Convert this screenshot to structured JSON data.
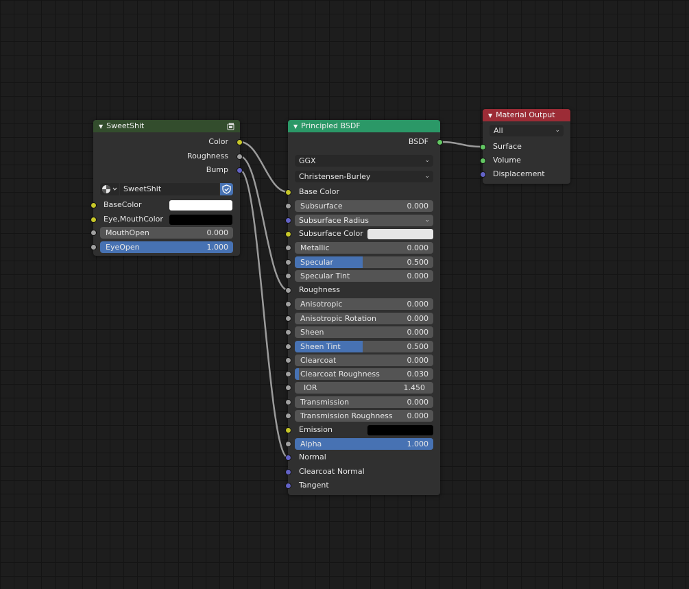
{
  "colors": {
    "group_header": "#334d2d",
    "shader_header": "#2b9867",
    "output_header": "#9c2c36",
    "accent_blue": "#4772b3",
    "socket_yellow": "#c7c729",
    "socket_gray": "#a1a1a1",
    "socket_blue": "#6363c7",
    "socket_green": "#63c763",
    "wire": "#9b9b9b"
  },
  "group_node": {
    "title": "SweetShit",
    "header_icon": "node-tree-icon",
    "outputs": [
      "Color",
      "Roughness",
      "Bump"
    ],
    "datablock_icon": "node-group-datablock-icon",
    "datablock_name": "SweetShit",
    "fake_user_icon": "shield-icon",
    "inputs": {
      "base_color": {
        "label": "BaseColor",
        "color": "#ffffff"
      },
      "eye_mouth_color": {
        "label": "Eye,MouthColor",
        "color": "#000000"
      },
      "mouth_open": {
        "label": "MouthOpen",
        "value": "0.000",
        "fraction": 0.0
      },
      "eye_open": {
        "label": "EyeOpen",
        "value": "1.000",
        "fraction": 1.0
      }
    }
  },
  "bsdf_node": {
    "title": "Principled BSDF",
    "output": "BSDF",
    "distribution": "GGX",
    "subsurface_method": "Christensen-Burley",
    "base_color": "Base Color",
    "subsurface": {
      "label": "Subsurface",
      "value": "0.000",
      "fraction": 0.0
    },
    "subsurface_radius": "Subsurface Radius",
    "subsurface_color": {
      "label": "Subsurface Color",
      "color": "#e6e6e6"
    },
    "metallic": {
      "label": "Metallic",
      "value": "0.000",
      "fraction": 0.0
    },
    "specular": {
      "label": "Specular",
      "value": "0.500",
      "fraction": 0.5
    },
    "specular_tint": {
      "label": "Specular Tint",
      "value": "0.000",
      "fraction": 0.0
    },
    "roughness": "Roughness",
    "anisotropic": {
      "label": "Anisotropic",
      "value": "0.000",
      "fraction": 0.0
    },
    "anisotropic_rotation": {
      "label": "Anisotropic Rotation",
      "value": "0.000",
      "fraction": 0.0
    },
    "sheen": {
      "label": "Sheen",
      "value": "0.000",
      "fraction": 0.0
    },
    "sheen_tint": {
      "label": "Sheen Tint",
      "value": "0.500",
      "fraction": 0.5
    },
    "clearcoat": {
      "label": "Clearcoat",
      "value": "0.000",
      "fraction": 0.0
    },
    "clearcoat_roughness": {
      "label": "Clearcoat Roughness",
      "value": "0.030",
      "fraction": 0.03
    },
    "ior": {
      "label": "IOR",
      "value": "1.450"
    },
    "transmission": {
      "label": "Transmission",
      "value": "0.000",
      "fraction": 0.0
    },
    "transmission_roughness": {
      "label": "Transmission Roughness",
      "value": "0.000",
      "fraction": 0.0
    },
    "emission": {
      "label": "Emission",
      "color": "#000000"
    },
    "alpha": {
      "label": "Alpha",
      "value": "1.000",
      "fraction": 1.0
    },
    "normal": "Normal",
    "clearcoat_normal": "Clearcoat Normal",
    "tangent": "Tangent"
  },
  "output_node": {
    "title": "Material Output",
    "target": "All",
    "inputs": [
      "Surface",
      "Volume",
      "Displacement"
    ]
  }
}
